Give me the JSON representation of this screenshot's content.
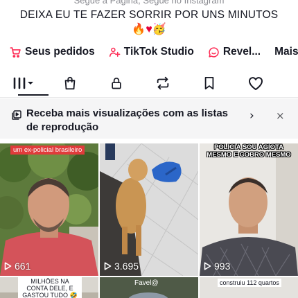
{
  "profile": {
    "bio_line_cut": "Segue a Página, Segue no Instagram",
    "bio": "DEIXA EU TE FAZER SORRIR POR UNS MINUTOS",
    "bio_emojis": [
      "🔥",
      "♥",
      "🥳"
    ]
  },
  "links": [
    {
      "label": "Seus pedidos",
      "icon": "cart-icon"
    },
    {
      "label": "TikTok Studio",
      "icon": "studio-icon"
    },
    {
      "label": "Revel...",
      "icon": "chat-smile-icon"
    },
    {
      "label": "Mais",
      "icon": ""
    }
  ],
  "tabs": [
    "videos-grid-icon",
    "shop-bag-icon",
    "lock-icon",
    "repost-icon",
    "bookmark-icon",
    "heart-icon"
  ],
  "banner": {
    "text": "Receba mais visualizações com as listas de reprodução",
    "chevron": "›",
    "close": "×"
  },
  "videos": [
    {
      "caption": "um ex-policial brasileiro",
      "views": "661"
    },
    {
      "caption": "",
      "views": "3.695"
    },
    {
      "caption": "POLICIA SOU AGIOTA MESMO E COBRO MESMO",
      "views": "993"
    }
  ],
  "videos_row2": [
    {
      "caption": "MILHÕES NA CONTA DELE, E GASTOU TUDO 🤣"
    },
    {
      "caption": "Favel@"
    },
    {
      "caption": "construiu 112 quartos"
    }
  ],
  "colors": {
    "accent": "#fe2c55",
    "text": "#161823",
    "banner_bg": "#f5f5f6"
  }
}
